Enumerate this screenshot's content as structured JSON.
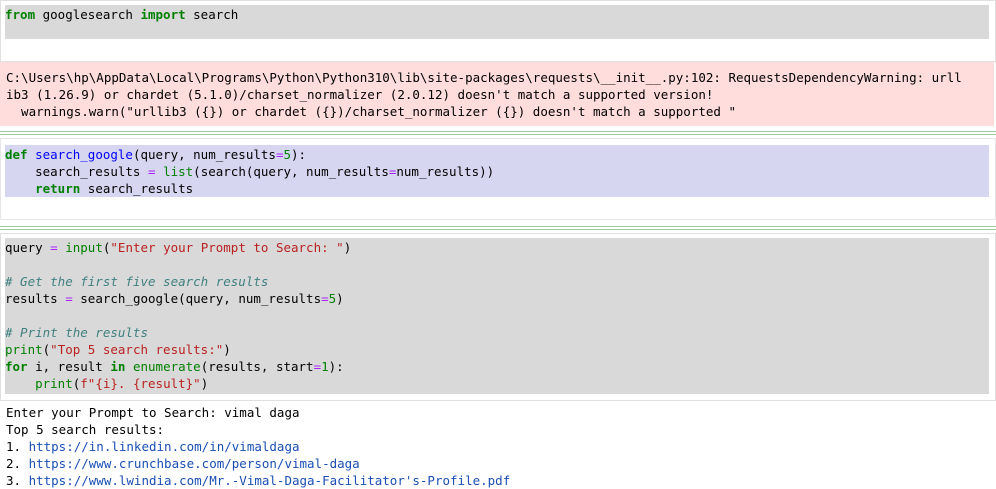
{
  "cell1": {
    "kw_from": "from",
    "module": " googlesearch ",
    "kw_import": "import",
    "name": " search"
  },
  "stderr": {
    "line1": "C:\\Users\\hp\\AppData\\Local\\Programs\\Python\\Python310\\lib\\site-packages\\requests\\__init__.py:102: RequestsDependencyWarning: urll",
    "line2": "ib3 (1.26.9) or chardet (5.1.0)/charset_normalizer (2.0.12) doesn't match a supported version!",
    "line3": "  warnings.warn(\"urllib3 ({}) or chardet ({})/charset_normalizer ({}) doesn't match a supported \""
  },
  "cell2": {
    "l1_def": "def",
    "l1_fn": "search_google",
    "l1_a": "(query, num_results",
    "l1_eq": "=",
    "l1_num": "5",
    "l1_b": "):",
    "l2_a": "    search_results ",
    "l2_eq": "=",
    "l2_sp": " ",
    "l2_list": "list",
    "l2_b": "(search(query, num_results",
    "l2_eq2": "=",
    "l2_c": "num_results))",
    "l3_ret": "    return",
    "l3_a": " search_results"
  },
  "cell3": {
    "l1_a": "query ",
    "l1_eq": "=",
    "l1_sp": " ",
    "l1_input": "input",
    "l1_p": "(",
    "l1_str": "\"Enter your Prompt to Search: \"",
    "l1_close": ")",
    "l3_comment": "# Get the first five search results",
    "l4_a": "results ",
    "l4_eq": "=",
    "l4_b": " search_google(query, num_results",
    "l4_eq2": "=",
    "l4_num": "5",
    "l4_close": ")",
    "l6_comment": "# Print the results",
    "l7_print": "print",
    "l7_p": "(",
    "l7_str": "\"Top 5 search results:\"",
    "l7_close": ")",
    "l8_for": "for",
    "l8_a": " i, result ",
    "l8_in": "in",
    "l8_sp": " ",
    "l8_enum": "enumerate",
    "l8_b": "(results, start",
    "l8_eq": "=",
    "l8_num": "1",
    "l8_c": "):",
    "l9_indent": "    ",
    "l9_print": "print",
    "l9_p": "(",
    "l9_str": "f\"{i}. {result}\"",
    "l9_close": ")"
  },
  "output": {
    "line1": "Enter your Prompt to Search: vimal daga",
    "line2": "Top 5 search results:",
    "r1_num": "1. ",
    "r1_url": "https://in.linkedin.com/in/vimaldaga",
    "r2_num": "2. ",
    "r2_url": "https://www.crunchbase.com/person/vimal-daga",
    "r3_num": "3. ",
    "r3_url": "https://www.lwindia.com/Mr.-Vimal-Daga-Facilitator's-Profile.pdf"
  }
}
